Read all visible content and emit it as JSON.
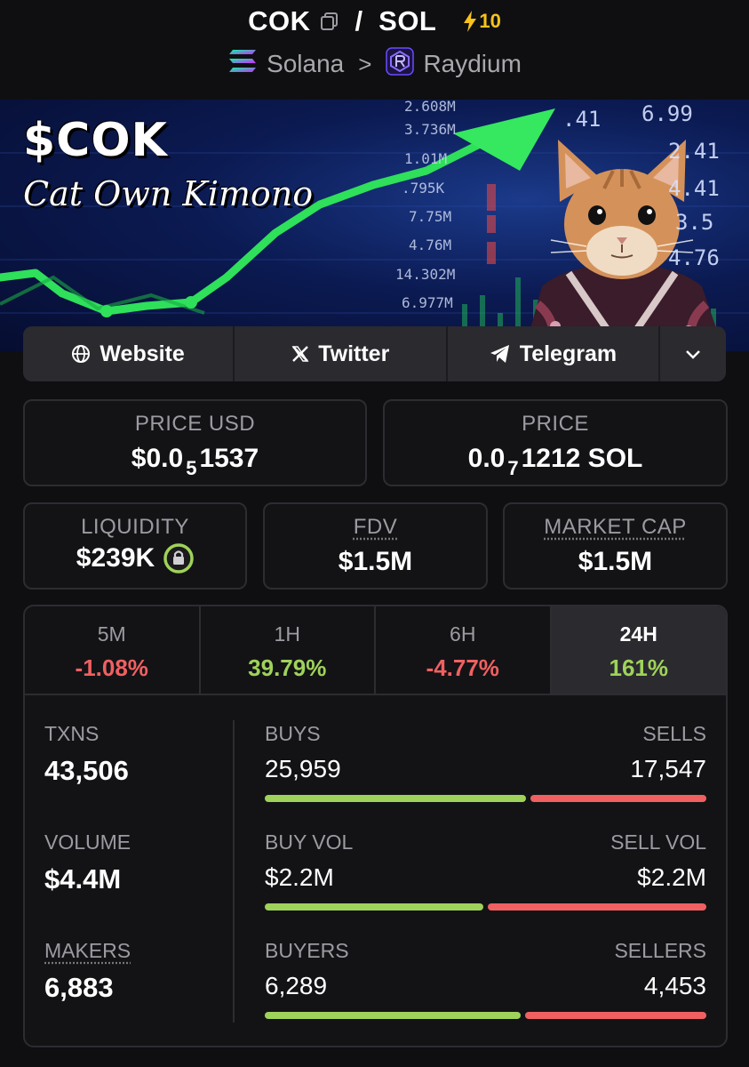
{
  "header": {
    "token": "COK",
    "quote": "SOL",
    "slash": "/",
    "boost_count": "10",
    "chain": "Solana",
    "dex": "Raydium",
    "separator": ">"
  },
  "banner": {
    "title": "$COK",
    "subtitle": "Cat Own Kimono",
    "ticker_values": [
      "2.608M",
      "3.736M",
      "1.01M",
      ".795K",
      "7.75M",
      "4.76M",
      "14.302M",
      "6.977M"
    ],
    "ticker_right": [
      ".41",
      "6.99",
      "2.41",
      "4.41",
      "3.5",
      "4.76"
    ]
  },
  "links": {
    "website": "Website",
    "twitter": "Twitter",
    "telegram": "Telegram"
  },
  "price_usd": {
    "label": "PRICE USD",
    "prefix": "$0.0",
    "zeros": "5",
    "digits": "1537"
  },
  "price_native": {
    "label": "PRICE",
    "prefix": "0.0",
    "zeros": "7",
    "digits": "1212 SOL"
  },
  "liquidity": {
    "label": "LIQUIDITY",
    "value": "$239K"
  },
  "fdv": {
    "label": "FDV",
    "value": "$1.5M"
  },
  "market_cap": {
    "label": "MARKET CAP",
    "value": "$1.5M"
  },
  "timeframes": [
    {
      "label": "5M",
      "value": "-1.08%",
      "direction": "down"
    },
    {
      "label": "1H",
      "value": "39.79%",
      "direction": "up"
    },
    {
      "label": "6H",
      "value": "-4.77%",
      "direction": "down"
    },
    {
      "label": "24H",
      "value": "161%",
      "direction": "up",
      "active": true
    }
  ],
  "stats": {
    "txns": {
      "label": "TXNS",
      "value": "43,506"
    },
    "volume": {
      "label": "VOLUME",
      "value": "$4.4M"
    },
    "makers": {
      "label": "MAKERS",
      "value": "6,883"
    },
    "buys": {
      "left_label": "BUYS",
      "right_label": "SELLS",
      "left_value": "25,959",
      "right_value": "17,547",
      "buy_fraction": 0.597
    },
    "vol": {
      "left_label": "BUY VOL",
      "right_label": "SELL VOL",
      "left_value": "$2.2M",
      "right_value": "$2.2M",
      "buy_fraction": 0.5
    },
    "buyers": {
      "left_label": "BUYERS",
      "right_label": "SELLERS",
      "left_value": "6,289",
      "right_value": "4,453",
      "buy_fraction": 0.585
    }
  },
  "colors": {
    "positive": "#9fd25a",
    "negative": "#f06061",
    "boost": "#f7c21b",
    "background": "#0f0f12"
  }
}
